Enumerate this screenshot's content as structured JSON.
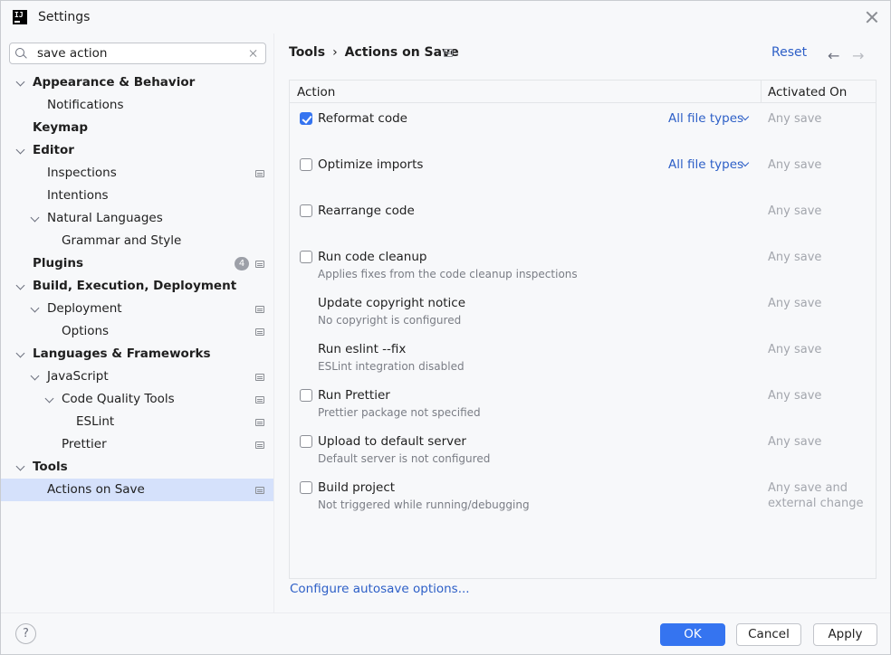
{
  "window": {
    "title": "Settings"
  },
  "search": {
    "value": "save action"
  },
  "tree": [
    {
      "label": "Appearance & Behavior",
      "bold": true,
      "chevron": "down"
    },
    {
      "label": "Notifications"
    },
    {
      "label": "Keymap",
      "bold": true
    },
    {
      "label": "Editor",
      "bold": true,
      "chevron": "down"
    },
    {
      "label": "Inspections",
      "icon": true
    },
    {
      "label": "Intentions"
    },
    {
      "label": "Natural Languages",
      "chevron": "down"
    },
    {
      "label": "Grammar and Style"
    },
    {
      "label": "Plugins",
      "bold": true,
      "badge": "4",
      "icon": true
    },
    {
      "label": "Build, Execution, Deployment",
      "bold": true,
      "chevron": "down"
    },
    {
      "label": "Deployment",
      "chevron": "down",
      "icon": true
    },
    {
      "label": "Options",
      "icon": true
    },
    {
      "label": "Languages & Frameworks",
      "bold": true,
      "chevron": "down"
    },
    {
      "label": "JavaScript",
      "chevron": "down",
      "icon": true
    },
    {
      "label": "Code Quality Tools",
      "chevron": "down",
      "icon": true
    },
    {
      "label": "ESLint",
      "icon": true
    },
    {
      "label": "Prettier",
      "icon": true
    },
    {
      "label": "Tools",
      "bold": true,
      "chevron": "down"
    },
    {
      "label": "Actions on Save",
      "selected": true,
      "icon": true
    }
  ],
  "breadcrumb": {
    "parent": "Tools",
    "separator": "›",
    "current": "Actions on Save"
  },
  "toolbar": {
    "reset": "Reset",
    "back": "←",
    "forward": "→"
  },
  "table": {
    "col_action": "Action",
    "col_activated": "Activated On",
    "rows": [
      {
        "title": "Reformat code",
        "checked": true,
        "link": "All file types",
        "when": "Any save"
      },
      {
        "title": "Optimize imports",
        "checked": false,
        "link": "All file types",
        "when": "Any save"
      },
      {
        "title": "Rearrange code",
        "checked": false,
        "when": "Any save"
      },
      {
        "title": "Run code cleanup",
        "checked": false,
        "sub": "Applies fixes from the code cleanup inspections",
        "when": "Any save"
      },
      {
        "title": "Update copyright notice",
        "sub": "No copyright is configured",
        "when": "Any save"
      },
      {
        "title": "Run eslint --fix",
        "sub": "ESLint integration disabled",
        "when": "Any save"
      },
      {
        "title": "Run Prettier",
        "checked": false,
        "sub": "Prettier package not specified",
        "when": "Any save"
      },
      {
        "title": "Upload to default server",
        "checked": false,
        "sub": "Default server is not configured",
        "when": "Any save"
      },
      {
        "title": "Build project",
        "checked": false,
        "sub": "Not triggered while running/debugging",
        "when": "Any save and external change"
      }
    ]
  },
  "configure_link": "Configure autosave options...",
  "footer": {
    "help": "?",
    "ok": "OK",
    "cancel": "Cancel",
    "apply": "Apply"
  },
  "colors": {
    "accent": "#3574f0",
    "link": "#2d5fc7",
    "selection": "#d5e1fb"
  }
}
